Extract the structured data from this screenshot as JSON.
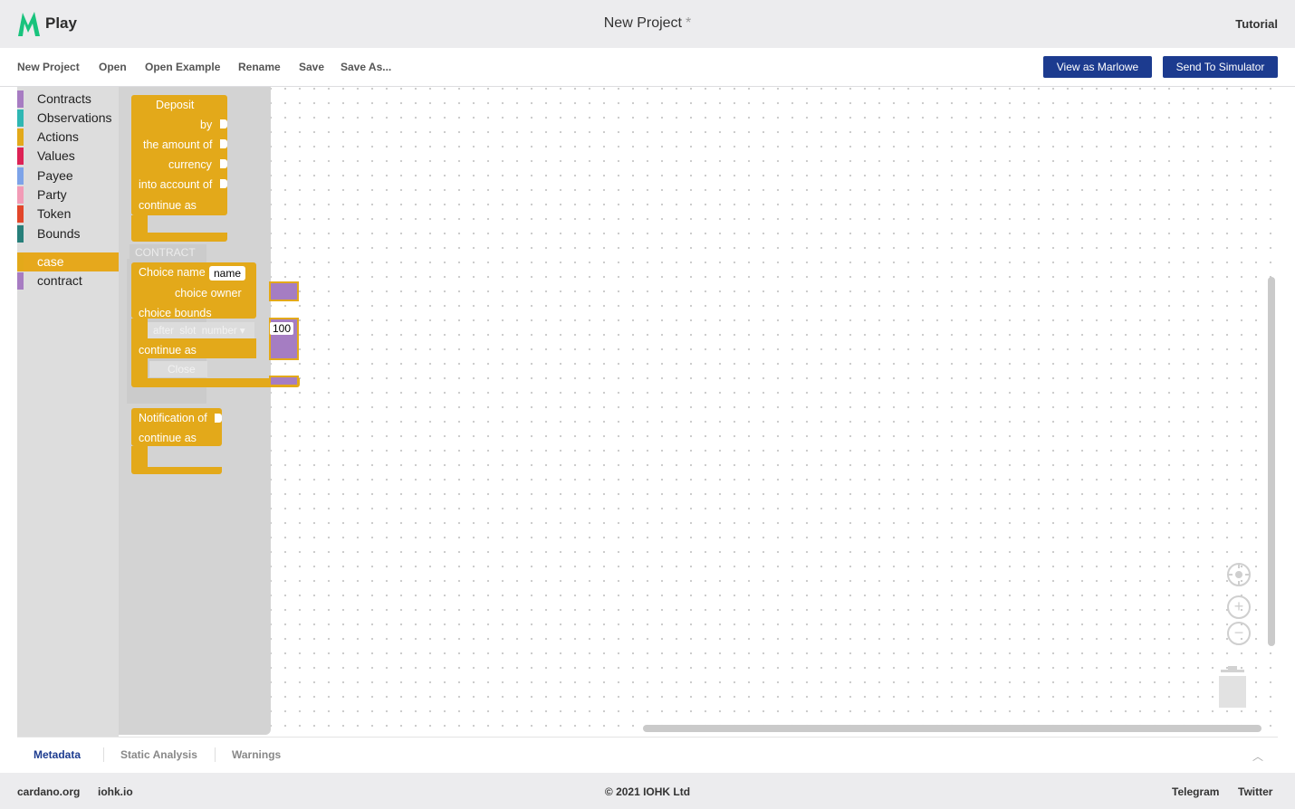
{
  "header": {
    "logo_text": "Play",
    "project_title": "New Project",
    "modified_marker": "*",
    "tutorial_label": "Tutorial"
  },
  "menu": {
    "new_project": "New Project",
    "open": "Open",
    "open_example": "Open Example",
    "rename": "Rename",
    "save": "Save",
    "save_as": "Save As...",
    "view_as_marlowe": "View as Marlowe",
    "send_to_simulator": "Send To Simulator"
  },
  "toolbox": {
    "categories": [
      {
        "label": "Contracts",
        "color": "#a77cc2"
      },
      {
        "label": "Observations",
        "color": "#2fb7b3"
      },
      {
        "label": "Actions",
        "color": "#e3a91a"
      },
      {
        "label": "Values",
        "color": "#dd2255"
      },
      {
        "label": "Payee",
        "color": "#7da3e8"
      },
      {
        "label": "Party",
        "color": "#f29bb6"
      },
      {
        "label": "Token",
        "color": "#e2462a"
      },
      {
        "label": "Bounds",
        "color": "#277f7a"
      }
    ],
    "extra": [
      {
        "label": "case",
        "color": "#e3a91a",
        "selected": true
      },
      {
        "label": "contract",
        "color": "#a77cc2",
        "selected": false
      }
    ]
  },
  "blocks": {
    "deposit": {
      "title": "Deposit",
      "by": "by",
      "amount": "the amount of",
      "currency": "currency",
      "account": "into account of",
      "continue": "continue as"
    },
    "ghost_contract": "CONTRACT",
    "choice": {
      "title": "Choice name",
      "name_field": "name",
      "owner": "choice owner",
      "bounds": "choice bounds",
      "ghost_after": "after",
      "ghost_slot": "slot",
      "ghost_number": "number",
      "number_value": "100",
      "continue": "continue as",
      "ghost_close": "Close"
    },
    "notification": {
      "title": "Notification of",
      "continue": "continue as"
    }
  },
  "bottom_tabs": {
    "metadata": "Metadata",
    "static_analysis": "Static Analysis",
    "warnings": "Warnings"
  },
  "footer": {
    "cardano": "cardano.org",
    "iohk": "iohk.io",
    "copyright": "© 2021 IOHK Ltd",
    "telegram": "Telegram",
    "twitter": "Twitter"
  },
  "colors": {
    "accent": "#1c3b8f",
    "block": "#e3a91a",
    "contract_block": "#a57dc2"
  }
}
